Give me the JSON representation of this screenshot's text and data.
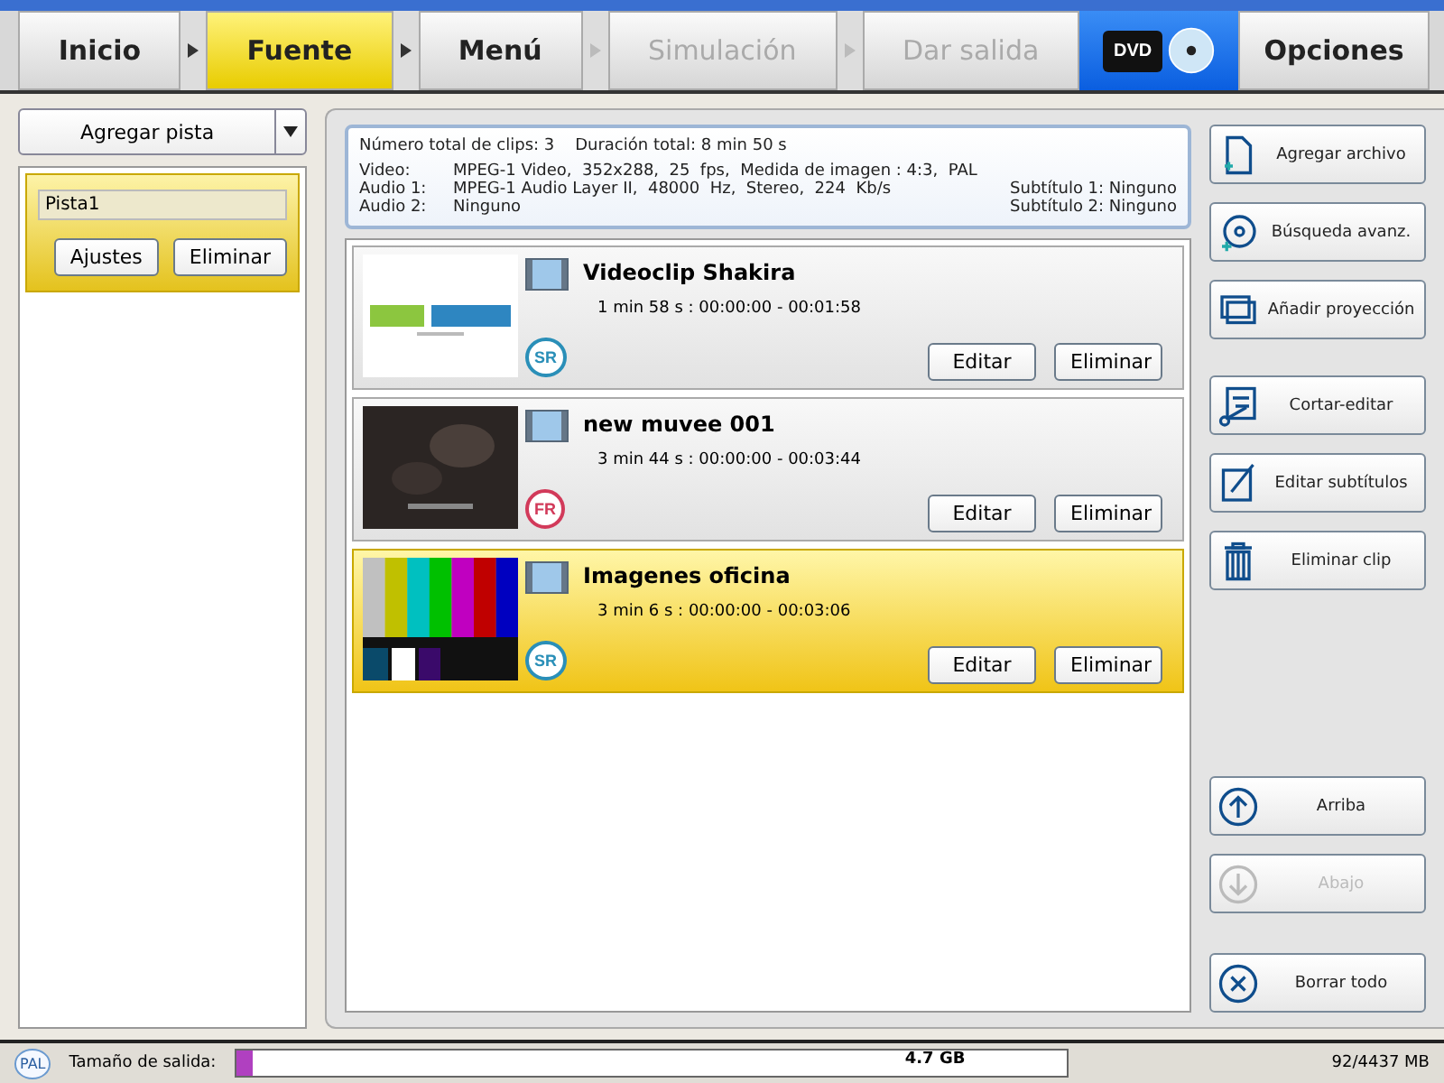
{
  "steps": [
    {
      "label": "Inicio",
      "selected": false,
      "disabled": false
    },
    {
      "label": "Fuente",
      "selected": true,
      "disabled": false
    },
    {
      "label": "Menú",
      "selected": false,
      "disabled": false
    },
    {
      "label": "Simulación",
      "selected": false,
      "disabled": true
    },
    {
      "label": "Dar salida",
      "selected": false,
      "disabled": true
    }
  ],
  "format_button": {
    "label": "DVD"
  },
  "options_button": {
    "label": "Opciones"
  },
  "track_dropdown": {
    "label": "Agregar pista"
  },
  "tracks": [
    {
      "name": "Pista1",
      "selected": true,
      "buttons": [
        "Ajustes",
        "Eliminar"
      ]
    }
  ],
  "summary": {
    "line1": "Número total de clips: 3    Duración total: 8 min 50 s",
    "rows": [
      {
        "label": "Video:",
        "value": "MPEG-1 Video,  352x288,  25  fps,  Medida de imagen : 4:3,  PAL"
      },
      {
        "label": "Audio 1:",
        "value": "MPEG-1 Audio Layer II,  48000  Hz,  Stereo,  224  Kb/s",
        "extra": "Subtítulo 1: Ninguno"
      },
      {
        "label": "Audio 2:",
        "value": "Ninguno",
        "extra": "Subtítulo 2: Ninguno"
      }
    ]
  },
  "clips": [
    {
      "title": "Videoclip Shakira",
      "duration": "1 min 58 s :  00:00:00 - 00:01:58",
      "badge": "SR",
      "color": "#2a8fb8",
      "selected": false,
      "buttons": [
        "Editar",
        "Eliminar"
      ]
    },
    {
      "title": "new muvee 001",
      "duration": "3 min 44 s :  00:00:00 - 00:03:44",
      "badge": "FR",
      "color": "#d23a5a",
      "selected": false,
      "buttons": [
        "Editar",
        "Eliminar"
      ]
    },
    {
      "title": "Imagenes oficina",
      "duration": "3 min 6 s :  00:00:00 - 00:03:06",
      "badge": "SR",
      "color": "#2a8fb8",
      "selected": true,
      "buttons": [
        "Editar",
        "Eliminar"
      ]
    }
  ],
  "actions": [
    {
      "label": "Agregar archivo",
      "disabled": false
    },
    {
      "label": "Búsqueda avanz.",
      "disabled": false
    },
    {
      "label": "Añadir proyección",
      "disabled": false
    },
    {
      "label": "Cortar-editar",
      "disabled": false
    },
    {
      "label": "Editar subtítulos",
      "disabled": false
    },
    {
      "label": "Eliminar clip",
      "disabled": false
    },
    {
      "label": "Arriba",
      "disabled": false
    },
    {
      "label": "Abajo",
      "disabled": true
    },
    {
      "label": "Borrar todo",
      "disabled": false
    }
  ],
  "status_bar": {
    "standard": "PAL",
    "label": "Tamaño de salida:",
    "capacity": "4.7 GB",
    "level": 0.02,
    "usage": "92/4437 MB"
  }
}
